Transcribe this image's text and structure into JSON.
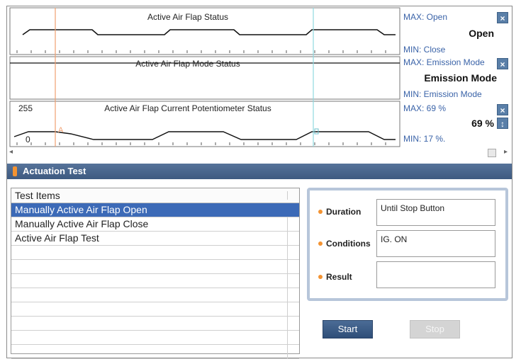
{
  "graphs": [
    {
      "title": "Active Air Flap Status",
      "max_label": "MAX: Open",
      "current": "Open",
      "min_label": "MIN: Close",
      "buttons": [
        "×"
      ]
    },
    {
      "title": "Active Air Flap Mode Status",
      "max_label": "MAX: Emission Mode",
      "current": "Emission Mode",
      "min_label": "MIN: Emission Mode",
      "buttons": [
        "×"
      ]
    },
    {
      "title": "Active Air Flap Current Potentiometer Status",
      "axis_top": "255",
      "axis_bottom": "0",
      "cursor_a": "A",
      "max_label": "MAX:     69 %",
      "current": "69 %",
      "min_label": "MIN:     17 %.",
      "buttons": [
        "×",
        "↕"
      ]
    }
  ],
  "scrollbar": {
    "left_arrow": "◂",
    "right_arrow": "▸"
  },
  "section": {
    "title": "Actuation Test"
  },
  "test_list": {
    "header": "Test Items",
    "items": [
      "Manually Active Air Flap Open",
      "Manually Active Air Flap Close",
      "Active Air Flap Test",
      "",
      "",
      "",
      "",
      "",
      "",
      "",
      ""
    ],
    "selected_index": 0
  },
  "details": {
    "duration_label": "Duration",
    "duration_value": "Until Stop Button",
    "conditions_label": "Conditions",
    "conditions_value": "IG. ON",
    "result_label": "Result",
    "result_value": ""
  },
  "buttons": {
    "start": "Start",
    "stop": "Stop"
  },
  "colors": {
    "accent": "#3c6ab7",
    "header_bar": "#46648c",
    "cursor_orange": "#f0a070",
    "cursor_cyan": "#8fd8e0",
    "marker_orange": "#f39332"
  }
}
